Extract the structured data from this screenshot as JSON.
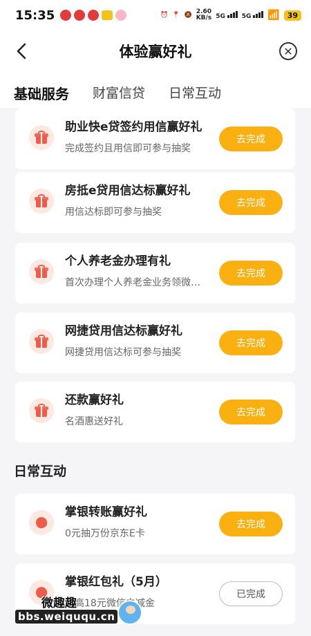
{
  "status": {
    "time": "15:35",
    "speed_value": "2.60",
    "speed_unit": "KB/s",
    "net1": "5G",
    "net2": "5G",
    "battery": "39"
  },
  "header": {
    "title": "体验赢好礼"
  },
  "tabs": [
    {
      "label": "基础服务",
      "active": true
    },
    {
      "label": "财富信贷",
      "active": false
    },
    {
      "label": "日常互动",
      "active": false
    }
  ],
  "basic_tasks": [
    {
      "title": "助业快e贷签约用信赢好礼",
      "subtitle": "完成签约且用信即可参与抽奖",
      "button": "去完成",
      "icon": "gift-icon"
    },
    {
      "title": "房抵e贷用信达标赢好礼",
      "subtitle": "用信达标即可参与抽奖",
      "button": "去完成",
      "icon": "gift-icon"
    },
    {
      "title": "个人养老金办理有礼",
      "subtitle": "首次办理个人养老金业务领微…",
      "button": "去完成",
      "icon": "gift-icon"
    },
    {
      "title": "网捷贷用信达标赢好礼",
      "subtitle": "网捷贷用信达标可参与抽奖",
      "button": "去完成",
      "icon": "gift-icon"
    },
    {
      "title": "还款赢好礼",
      "subtitle": "名酒惠送好礼",
      "button": "去完成",
      "icon": "gift-icon"
    }
  ],
  "daily_section_title": "日常互动",
  "daily_tasks": [
    {
      "title": "掌银转账赢好礼",
      "subtitle": "0元抽万份京东E卡",
      "button": "去完成",
      "icon": "heart-icon"
    },
    {
      "title": "掌银红包礼（5月）",
      "subtitle": "最高18元微信立减金",
      "button": "已完成",
      "icon": "heart-icon"
    }
  ],
  "watermark": {
    "top": "微趣趣",
    "url": "bbs.weiququ.cn"
  }
}
